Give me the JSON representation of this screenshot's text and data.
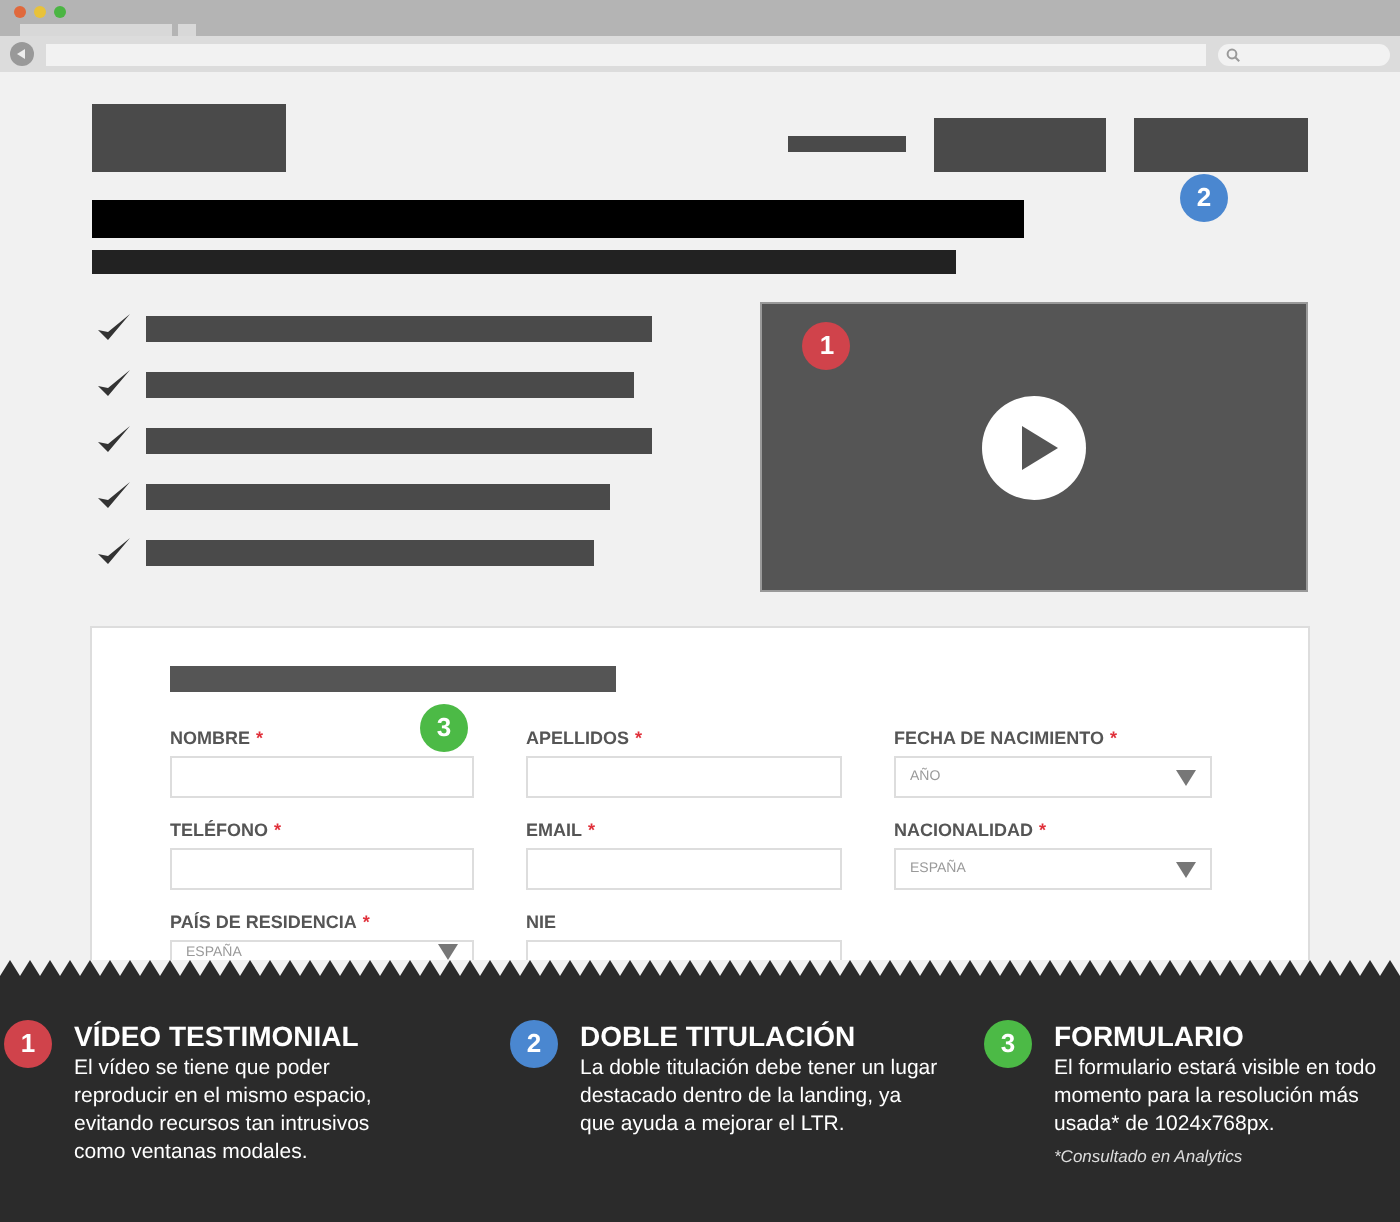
{
  "header": {
    "marker": {
      "number": "2",
      "color": "#4a87d0"
    }
  },
  "video": {
    "marker": {
      "number": "1",
      "color": "#d0434b"
    }
  },
  "form": {
    "marker": {
      "number": "3",
      "color": "#4cba46"
    },
    "fields": [
      {
        "label": "NOMBRE",
        "mark": "*",
        "kind": "text"
      },
      {
        "label": "APELLIDOS",
        "mark": "*",
        "kind": "text"
      },
      {
        "label": "FECHA DE NACIMIENTO",
        "mark": "*",
        "kind": "select",
        "placeholder": "AÑO"
      },
      {
        "label": "TELÉFONO",
        "mark": "*",
        "kind": "text"
      },
      {
        "label": "EMAIL",
        "mark": "*",
        "kind": "text"
      },
      {
        "label": "NACIONALIDAD",
        "mark": "*",
        "kind": "select",
        "placeholder": "ESPAÑA"
      },
      {
        "label": "PAÍS DE RESIDENCIA",
        "mark": "*",
        "kind": "select",
        "placeholder": "ESPAÑA"
      },
      {
        "label": "NIE",
        "kind": "text"
      }
    ]
  },
  "notes": [
    {
      "number": "1",
      "color": "#d0434b",
      "title": "VÍDEO TESTIMONIAL",
      "text": "El vídeo se tiene que poder reproducir en el mismo espacio, evitando recursos tan intrusivos como ventanas modales."
    },
    {
      "number": "2",
      "color": "#4a87d0",
      "title": "DOBLE TITULACIÓN",
      "text": "La doble titulación debe tener un lugar destacado dentro de la landing, ya que ayuda a mejorar el LTR."
    },
    {
      "number": "3",
      "color": "#4cba46",
      "title": "FORMULARIO",
      "text": "El formulario estará visible en todo momento para la resolución más usada* de 1024x768px.",
      "note": "*Consultado en Analytics"
    }
  ]
}
